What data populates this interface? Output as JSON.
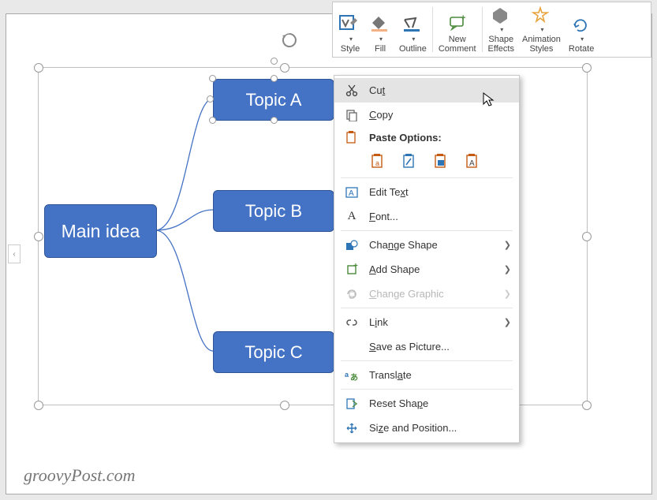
{
  "toolbar": {
    "style": "Style",
    "fill": "Fill",
    "outline": "Outline",
    "new_comment": "New\nComment",
    "shape_effects": "Shape\nEffects",
    "animation_styles": "Animation\nStyles",
    "rotate": "Rotate"
  },
  "smartart": {
    "main": "Main idea",
    "topics": [
      "Topic A",
      "Topic B",
      "Topic C"
    ],
    "sub_visible_letter": "C"
  },
  "context_menu": {
    "cut": "Cut",
    "copy": "Copy",
    "paste_options": "Paste Options:",
    "edit_text": "Edit Text",
    "font": "Font...",
    "change_shape": "Change Shape",
    "add_shape": "Add Shape",
    "change_graphic": "Change Graphic",
    "link": "Link",
    "save_as_picture": "Save as Picture...",
    "translate": "Translate",
    "reset_shape": "Reset Shape",
    "size_and_position": "Size and Position..."
  },
  "watermark": "groovyPost.com",
  "colors": {
    "accent": "#4472C4",
    "fill_underline": "#F4B183",
    "outline_underline": "#2E75B6"
  }
}
